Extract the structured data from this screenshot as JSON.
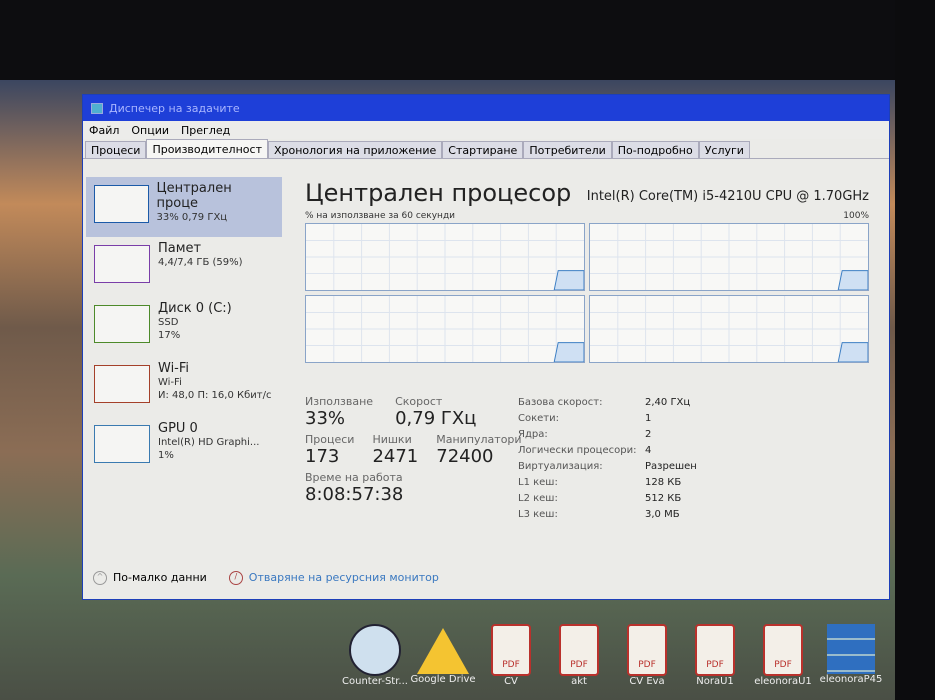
{
  "window": {
    "title": "Диспечер на задачите"
  },
  "menu": [
    "Файл",
    "Опции",
    "Преглед"
  ],
  "tabs": [
    "Процеси",
    "Производителност",
    "Хронология на приложение",
    "Стартиране",
    "Потребители",
    "По-подробно",
    "Услуги"
  ],
  "sidebar": [
    {
      "title": "Централен проце",
      "line1": "33% 0,79 ГХц",
      "line2": "",
      "color": "#1b5aa8"
    },
    {
      "title": "Памет",
      "line1": "4,4/7,4 ГБ (59%)",
      "line2": "",
      "color": "#7a3ea8"
    },
    {
      "title": "Диск 0 (C:)",
      "line1": "SSD",
      "line2": "17%",
      "color": "#4d8a2a"
    },
    {
      "title": "Wi-Fi",
      "line1": "Wi-Fi",
      "line2": "И: 48,0 П: 16,0 Кбит/с",
      "color": "#a4402a"
    },
    {
      "title": "GPU 0",
      "line1": "Intel(R) HD Graphi...",
      "line2": "1%",
      "color": "#3a7ab0"
    }
  ],
  "main": {
    "title": "Централен процесор",
    "model": "Intel(R) Core(TM) i5-4210U CPU @ 1.70GHz",
    "graph_label": "% на използване за 60 секунди",
    "graph_max": "100%"
  },
  "stats": {
    "usage_label": "Използване",
    "usage": "33%",
    "speed_label": "Скорост",
    "speed": "0,79 ГХц",
    "proc_label": "Процеси",
    "proc": "173",
    "threads_label": "Нишки",
    "threads": "2471",
    "handles_label": "Манипулатори",
    "handles": "72400",
    "uptime_label": "Време на работа",
    "uptime": "8:08:57:38"
  },
  "specs": [
    {
      "k": "Базова скорост:",
      "v": "2,40 ГХц"
    },
    {
      "k": "Сокети:",
      "v": "1"
    },
    {
      "k": "Ядра:",
      "v": "2"
    },
    {
      "k": "Логически процесори:",
      "v": "4"
    },
    {
      "k": "Виртуализация:",
      "v": "Разрешен"
    },
    {
      "k": "L1 кеш:",
      "v": "128 КБ"
    },
    {
      "k": "L2 кеш:",
      "v": "512 КБ"
    },
    {
      "k": "L3 кеш:",
      "v": "3,0 МБ"
    }
  ],
  "footer": {
    "less": "По-малко данни",
    "monitor": "Отваряне на ресурсния монитор"
  },
  "desktop": [
    "Counter-Str...",
    "Google Drive",
    "CV",
    "akt",
    "CV Eva",
    "NoraU1",
    "eleonoraU1",
    "eleonoraP45"
  ],
  "pdf_label": "PDF"
}
